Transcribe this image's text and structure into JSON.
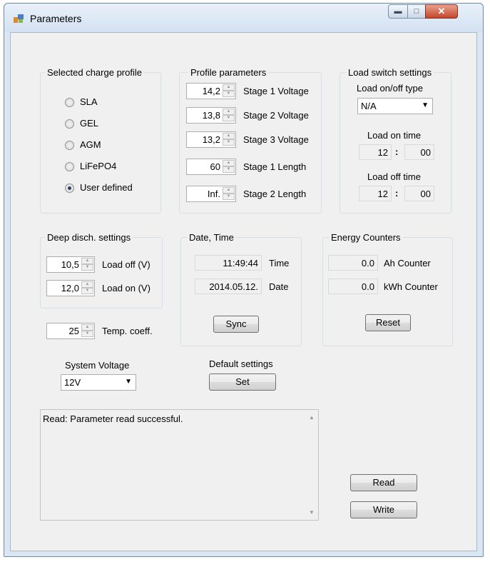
{
  "window": {
    "title": "Parameters"
  },
  "charge_profile": {
    "legend": "Selected charge profile",
    "options": [
      {
        "label": "SLA",
        "checked": false
      },
      {
        "label": "GEL",
        "checked": false
      },
      {
        "label": "AGM",
        "checked": false
      },
      {
        "label": "LiFePO4",
        "checked": false
      },
      {
        "label": "User defined",
        "checked": true
      }
    ]
  },
  "profile_params": {
    "legend": "Profile parameters",
    "rows": [
      {
        "value": "14,2",
        "label": "Stage 1 Voltage"
      },
      {
        "value": "13,8",
        "label": "Stage 2 Voltage"
      },
      {
        "value": "13,2",
        "label": "Stage 3 Voltage"
      },
      {
        "value": "60",
        "label": "Stage 1 Length"
      },
      {
        "value": "Inf.",
        "label": "Stage 2 Length"
      }
    ]
  },
  "load_switch": {
    "legend": "Load switch settings",
    "type_label": "Load on/off type",
    "type_value": "N/A",
    "on_label": "Load on time",
    "on_hour": "12",
    "on_min": "00",
    "off_label": "Load off time",
    "off_hour": "12",
    "off_min": "00",
    "colon": ":"
  },
  "deep_disch": {
    "legend": "Deep disch. settings",
    "rows": [
      {
        "value": "10,5",
        "label": "Load off (V)"
      },
      {
        "value": "12,0",
        "label": "Load on (V)"
      }
    ]
  },
  "temp_coeff": {
    "value": "25",
    "label": "Temp. coeff."
  },
  "date_time": {
    "legend": "Date, Time",
    "time_value": "11:49:44",
    "time_label": "Time",
    "date_value": "2014.05.12.",
    "date_label": "Date",
    "sync_label": "Sync"
  },
  "energy": {
    "legend": "Energy Counters",
    "ah_value": "0.0",
    "ah_label": "Ah Counter",
    "kwh_value": "0.0",
    "kwh_label": "kWh Counter",
    "reset_label": "Reset"
  },
  "system_voltage": {
    "label": "System Voltage",
    "value": "12V"
  },
  "default_settings": {
    "label": "Default settings",
    "set_label": "Set"
  },
  "log": {
    "text": "Read: Parameter read successful."
  },
  "actions": {
    "read_label": "Read",
    "write_label": "Write"
  }
}
